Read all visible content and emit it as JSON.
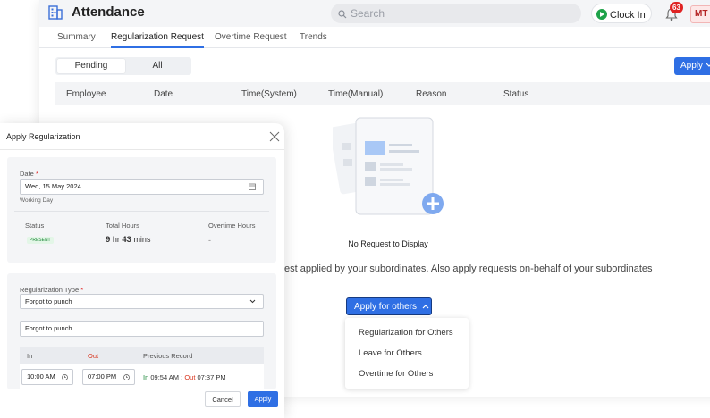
{
  "app": {
    "title": "Attendance",
    "search_placeholder": "Search",
    "clock_in_label": "Clock In",
    "notification_count": "63",
    "avatar_initials": "MT"
  },
  "tabs": [
    "Summary",
    "Regularization Request",
    "Overtime Request",
    "Trends"
  ],
  "segment": {
    "pending": "Pending",
    "all": "All"
  },
  "apply_button": "Apply",
  "table": {
    "columns": [
      "Employee",
      "Date",
      "Time(System)",
      "Time(Manual)",
      "Reason",
      "Status"
    ]
  },
  "empty": {
    "title": "No Request to Display",
    "description": "est applied by your subordinates. Also apply requests on-behalf of your subordinates"
  },
  "apply_others": {
    "label": "Apply for others",
    "options": [
      "Regularization for Others",
      "Leave for Others",
      "Overtime for Others"
    ]
  },
  "modal": {
    "title": "Apply Regularization",
    "date_label": "Date",
    "date_value": "Wed, 15 May 2024",
    "day_type": "Working Day",
    "status_label": "Status",
    "status_value": "PRESENT",
    "total_hours_label": "Total Hours",
    "total_hours_h": "9",
    "total_hours_h_unit": "hr",
    "total_hours_m": "43",
    "total_hours_m_unit": "mins",
    "overtime_label": "Overtime Hours",
    "overtime_value": "-",
    "reg_type_label": "Regularization Type",
    "reg_type_value": "Forgot to punch",
    "reason_value": "Forgot to punch",
    "in_label": "In",
    "out_label": "Out",
    "prev_label": "Previous Record",
    "in_time": "10:00 AM",
    "out_time": "07:00 PM",
    "prev_in_label": "In",
    "prev_in_time": "09:54 AM :",
    "prev_out_label": "Out",
    "prev_out_time": "07:37 PM",
    "cancel_label": "Cancel",
    "apply_label": "Apply"
  },
  "colors": {
    "accent": "#2f6fe4",
    "danger": "#e02424",
    "success": "#1fa34a"
  }
}
